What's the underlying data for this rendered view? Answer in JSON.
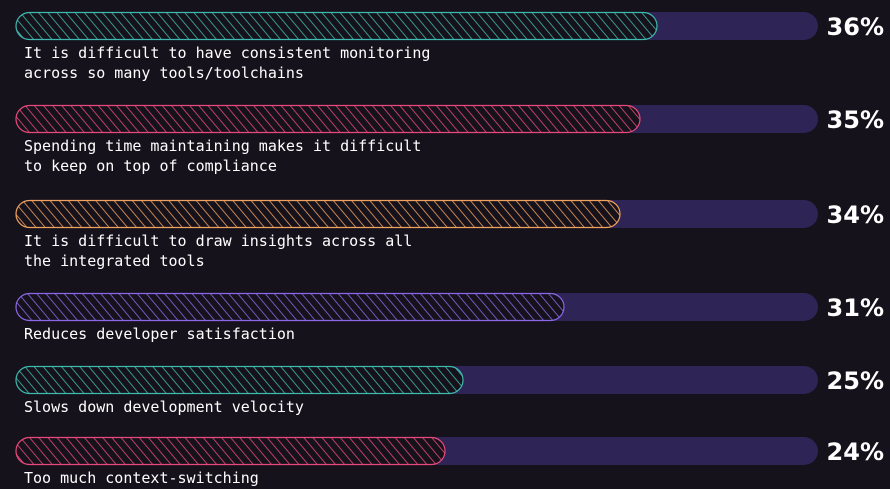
{
  "chart_data": {
    "type": "bar",
    "orientation": "horizontal",
    "unit": "%",
    "xlim": [
      0,
      50
    ],
    "grid": false,
    "legend": "none",
    "track_color": "#2e2455",
    "background_color": "#16121c",
    "bars": [
      {
        "value": 36,
        "value_label": "36%",
        "label_lines": [
          "It is difficult to have consistent monitoring",
          "across so many tools/toolchains"
        ],
        "color": "#3fb8ad"
      },
      {
        "value": 35,
        "value_label": "35%",
        "label_lines": [
          "Spending time maintaining makes it difficult",
          "to keep on top of compliance"
        ],
        "color": "#e8497a"
      },
      {
        "value": 34,
        "value_label": "34%",
        "label_lines": [
          "It is difficult to draw insights across all",
          "the integrated tools"
        ],
        "color": "#f0a15e"
      },
      {
        "value": 31,
        "value_label": "31%",
        "label_lines": [
          "Reduces developer satisfaction"
        ],
        "color": "#8a68e8"
      },
      {
        "value": 25,
        "value_label": "25%",
        "label_lines": [
          "Slows down development velocity"
        ],
        "color": "#3fb8ad"
      },
      {
        "value": 24,
        "value_label": "24%",
        "label_lines": [
          "Too much context-switching"
        ],
        "color": "#e8497a"
      }
    ]
  }
}
